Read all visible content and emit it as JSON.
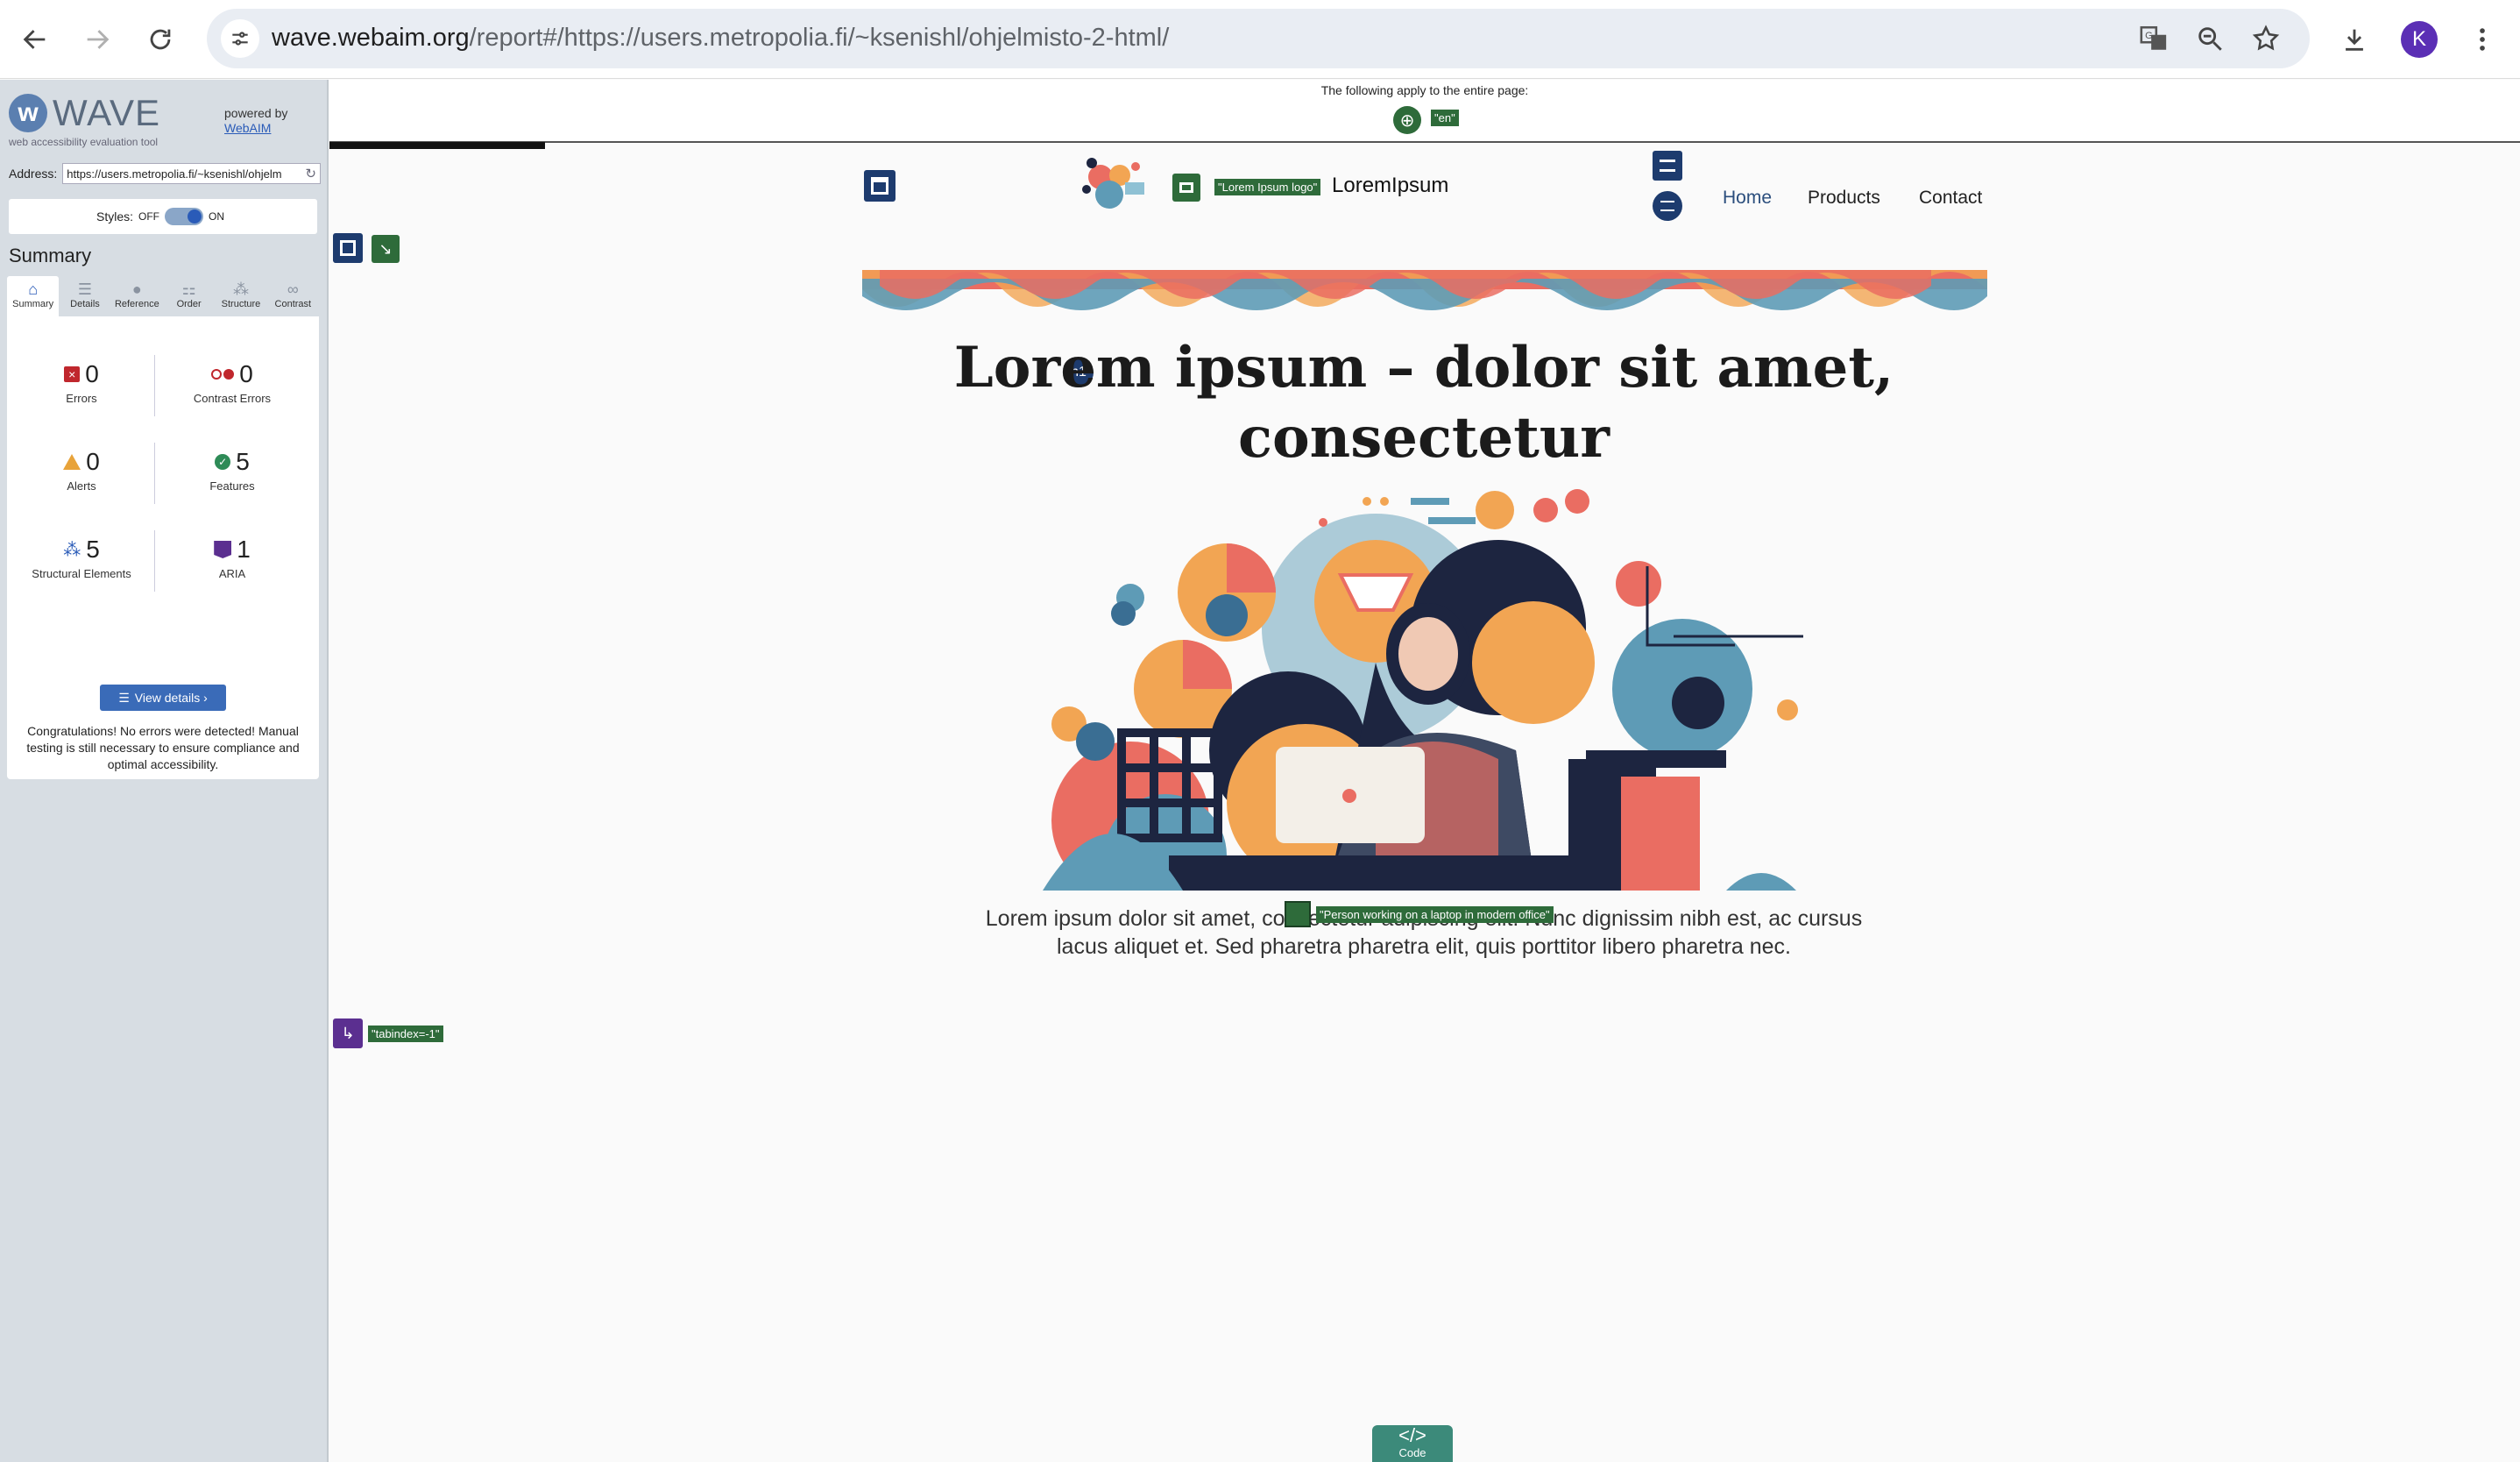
{
  "browser": {
    "url_domain": "wave.webaim.org",
    "url_path": "/report#/https://users.metropolia.fi/~ksenishl/ohjelmisto-2-html/",
    "avatar_letter": "K"
  },
  "wave": {
    "logo_text": "WAVE",
    "tagline": "web accessibility evaluation tool",
    "powered_by": "powered by",
    "powered_link": "WebAIM",
    "address_label": "Address:",
    "address_value": "https://users.metropolia.fi/~ksenishl/ohjelm",
    "styles_label": "Styles:",
    "styles_off": "OFF",
    "styles_on": "ON",
    "summary_heading": "Summary",
    "tabs": [
      {
        "label": "Summary",
        "icon": "home-icon"
      },
      {
        "label": "Details",
        "icon": "list-icon"
      },
      {
        "label": "Reference",
        "icon": "info-icon"
      },
      {
        "label": "Order",
        "icon": "order-icon"
      },
      {
        "label": "Structure",
        "icon": "structure-icon"
      },
      {
        "label": "Contrast",
        "icon": "contrast-icon"
      }
    ],
    "stats": {
      "errors": {
        "value": "0",
        "label": "Errors"
      },
      "contrast_errors": {
        "value": "0",
        "label": "Contrast Errors"
      },
      "alerts": {
        "value": "0",
        "label": "Alerts"
      },
      "features": {
        "value": "5",
        "label": "Features"
      },
      "structural": {
        "value": "5",
        "label": "Structural Elements"
      },
      "aria": {
        "value": "1",
        "label": "ARIA"
      }
    },
    "view_details": "View details ›",
    "congrats": "Congratulations! No errors were detected! Manual testing is still necessary to ensure compliance and optimal accessibility.",
    "page_bar_text": "The following apply to the entire page:",
    "lang_tag": "\"en\"",
    "logo_alt_tag": "\"Lorem Ipsum logo\"",
    "img_alt_tag": "\"Person working on a laptop in modern office\"",
    "tabindex_tag": "\"tabindex=-1\"",
    "code_label": "Code",
    "code_symbol": "</>"
  },
  "site": {
    "brand": "LoremIpsum",
    "nav": [
      "Home",
      "Products",
      "Contact"
    ],
    "hero_title": "Lorem ipsum – dolor sit amet, consectetur",
    "hero_text": "Lorem ipsum dolor sit amet, consectetur adipiscing elit. Nunc dignissim nibh est, ac cursus lacus aliquet et. Sed pharetra pharetra elit, quis porttitor libero pharetra nec.",
    "h1_badge": "h1"
  },
  "colors": {
    "wave_sidebar": "#d7dde3",
    "wave_blue": "#1d3b6e",
    "wave_green": "#2e6b3a",
    "wave_purple": "#5b2f90",
    "accent_coral": "#ea6d62",
    "accent_orange": "#f2a553",
    "accent_teal": "#5e9bb6"
  }
}
